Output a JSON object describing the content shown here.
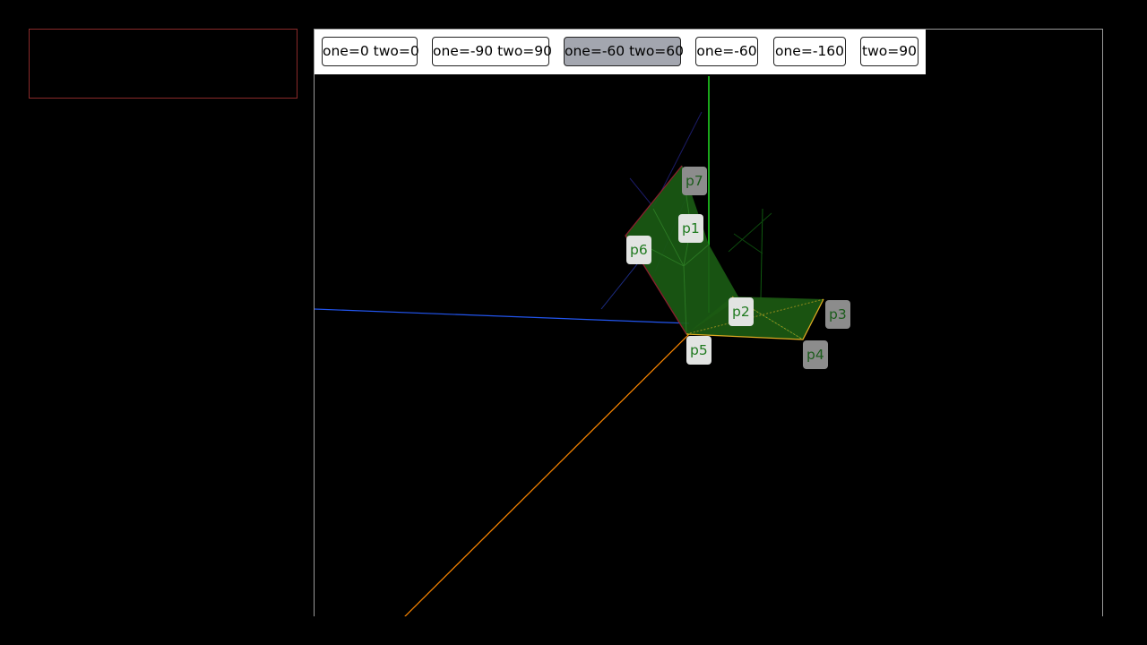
{
  "toolbar": {
    "buttons": [
      {
        "label": "one=0 two=0",
        "active": false
      },
      {
        "label": "one=-90 two=90",
        "active": false
      },
      {
        "label": "one=-60 two=60",
        "active": true
      },
      {
        "label": "one=-60",
        "active": false
      },
      {
        "label": "one=-160",
        "active": false
      },
      {
        "label": "two=90",
        "active": false
      }
    ]
  },
  "points": {
    "p1": "p1",
    "p2": "p2",
    "p3": "p3",
    "p4": "p4",
    "p5": "p5",
    "p6": "p6",
    "p7": "p7"
  },
  "colors": {
    "background": "#000000",
    "surface_fill": "#1a5a14",
    "axis_x": "#ff8800",
    "axis_y": "#22dd22",
    "axis_z": "#2255ee",
    "edge_highlight": "#ddaa22",
    "active_button": "#a3a6af"
  }
}
